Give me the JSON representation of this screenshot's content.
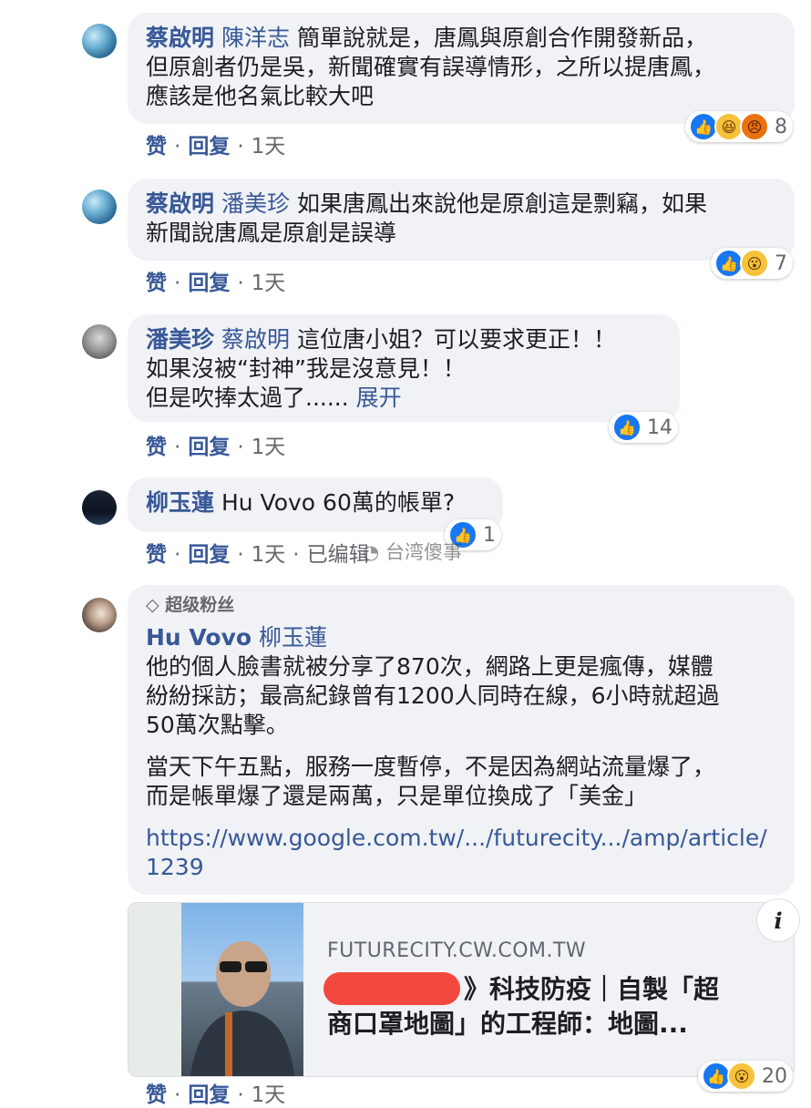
{
  "comments": [
    {
      "author": "蔡啟明",
      "mention": "陳洋志",
      "text_lines": [
        "簡單說就是，唐鳳與原創合作開發新品，",
        "但原創者仍是吳，新聞確實有誤導情形，之所以提唐鳳，",
        "應該是他名氣比較大吧"
      ],
      "reactions": {
        "icons": [
          "like-icon",
          "haha-icon",
          "angry-icon"
        ],
        "count": "8"
      },
      "actions": [
        "赞",
        "回复",
        "1天"
      ]
    },
    {
      "author": "蔡啟明",
      "mention": "潘美珍",
      "text_lines": [
        "如果唐鳳出來說他是原創這是剽竊，如果",
        "新聞說唐鳳是原創是誤導"
      ],
      "reactions": {
        "icons": [
          "like-icon",
          "wow-icon"
        ],
        "count": "7"
      },
      "actions": [
        "赞",
        "回复",
        "1天"
      ]
    },
    {
      "author": "潘美珍",
      "mention": "蔡啟明",
      "text_lines": [
        "這位唐小姐？可以要求更正！！",
        "如果沒被“封神”我是沒意見！！",
        "但是吹捧太過了......"
      ],
      "expand": "展开",
      "reactions": {
        "icons": [
          "like-icon"
        ],
        "count": "14"
      },
      "actions": [
        "赞",
        "回复",
        "1天"
      ]
    },
    {
      "author": "柳玉蓮",
      "text_lines": [
        "Hu Vovo 60萬的帳單?"
      ],
      "reactions": {
        "icons": [
          "like-icon"
        ],
        "count": "1"
      },
      "actions": [
        "赞",
        "回复",
        "1天",
        "已编辑"
      ]
    },
    {
      "badge": "超级粉丝",
      "author": "Hu Vovo",
      "mention": "柳玉蓮",
      "para1": [
        "他的個人臉書就被分享了870次，網路上更是瘋傳，媒體",
        "紛紛採訪；最高紀錄曾有1200人同時在線，6小時就超過",
        "50萬次點擊。"
      ],
      "para2": [
        "當天下午五點，服務一度暫停，不是因為網站流量爆了，",
        "而是帳單爆了還是兩萬，只是單位換成了「美金」"
      ],
      "link_lines": [
        "https://www.google.com.tw/.../futurecity.../amp/article/",
        "1239"
      ],
      "preview": {
        "domain": "FUTURECITY.CW.COM.TW",
        "title_lines": [
          "》科技防疫｜自製「超",
          "商口罩地圖」的工程師：地圖..."
        ]
      },
      "reactions": {
        "icons": [
          "like-icon",
          "wow-icon"
        ],
        "count": "20"
      },
      "actions": [
        "赞",
        "回复",
        "1天"
      ]
    }
  ],
  "watermark": "台湾傻事"
}
